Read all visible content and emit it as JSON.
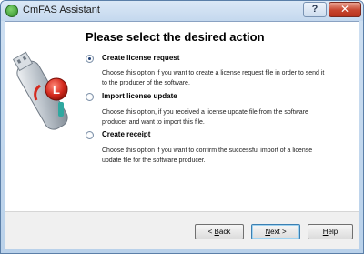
{
  "window": {
    "title": "CmFAS Assistant",
    "help_glyph": "?",
    "close_glyph": "✕"
  },
  "page": {
    "heading": "Please select the desired action"
  },
  "options": [
    {
      "label": "Create license request",
      "selected": true,
      "desc_line1": "Choose this option if you want to create a license request file in order to send it",
      "desc_line2": "to the producer of the software."
    },
    {
      "label": "Import license update",
      "selected": false,
      "desc_line1": "Choose this option, if you received a license update file from the software",
      "desc_line2": "producer and want to import this file."
    },
    {
      "label": "Create receipt",
      "selected": false,
      "desc_line1": "Choose this option if you want to confirm the successful import of a license",
      "desc_line2": "update file for the software producer."
    }
  ],
  "buttons": {
    "back": {
      "pre": "< ",
      "mnemonic": "B",
      "post": "ack"
    },
    "next": {
      "pre": "",
      "mnemonic": "N",
      "post": "ext >"
    },
    "help": {
      "pre": "",
      "mnemonic": "H",
      "post": "elp"
    }
  },
  "colors": {
    "accent": "#1f3f74",
    "dongle_red": "#d42a1e",
    "dongle_silver": "#b8c0c8"
  }
}
